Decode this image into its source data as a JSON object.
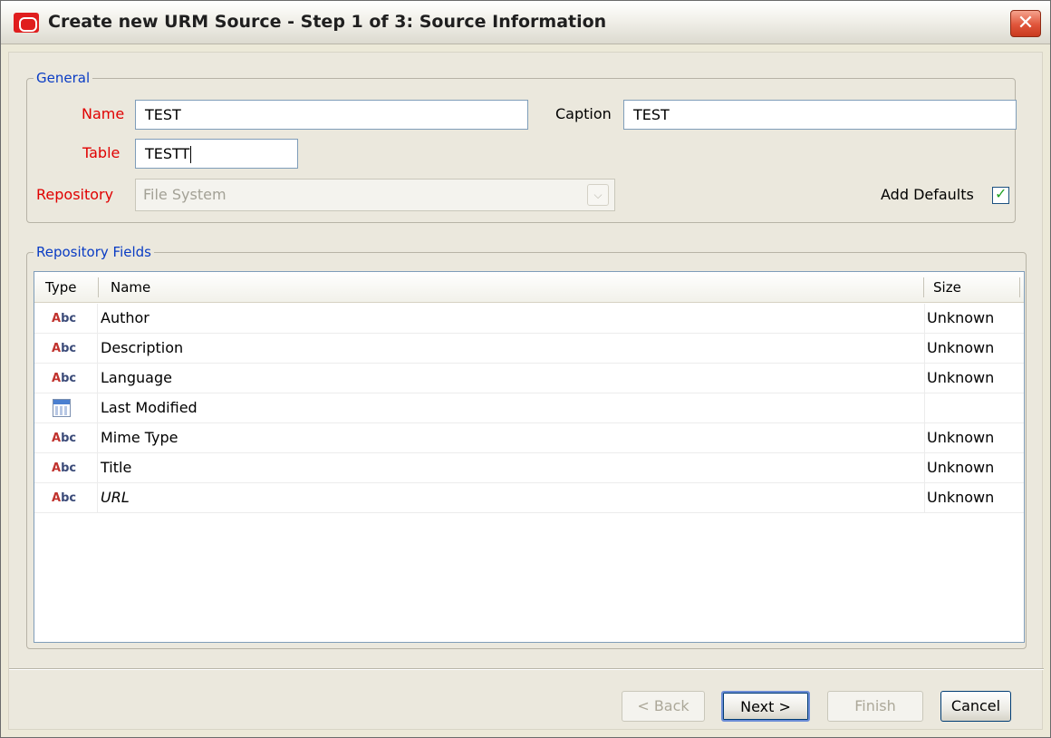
{
  "window": {
    "title": "Create new URM Source - Step 1 of 3: Source Information"
  },
  "general": {
    "legend": "General",
    "name_label": "Name",
    "name_value": "TEST",
    "caption_label": "Caption",
    "caption_value": "TEST",
    "table_label": "Table",
    "table_value": "TESTT",
    "repository_label": "Repository",
    "repository_value": "File System",
    "add_defaults_label": "Add Defaults",
    "add_defaults_checked": true
  },
  "repository_fields": {
    "legend": "Repository Fields",
    "columns": [
      "Type",
      "Name",
      "Size"
    ],
    "rows": [
      {
        "type": "text",
        "icon_text": "Abc",
        "name": "Author",
        "size": "Unknown"
      },
      {
        "type": "text",
        "icon_text": "Abc",
        "name": "Description",
        "size": "Unknown"
      },
      {
        "type": "text",
        "icon_text": "Abc",
        "name": "Language",
        "size": "Unknown"
      },
      {
        "type": "date",
        "icon_text": "",
        "name": "Last Modified",
        "size": ""
      },
      {
        "type": "text",
        "icon_text": "Abc",
        "name": "Mime Type",
        "size": "Unknown"
      },
      {
        "type": "text",
        "icon_text": "Abc",
        "name": "Title",
        "size": "Unknown"
      },
      {
        "type": "text",
        "icon_text": "Abc",
        "name": "URL",
        "size": "Unknown"
      }
    ]
  },
  "buttons": {
    "back": "< Back",
    "next": "Next >",
    "finish": "Finish",
    "cancel": "Cancel"
  },
  "colors": {
    "required_label": "#e00000",
    "legend": "#0a3cc4",
    "close_button": "#e0553a"
  }
}
